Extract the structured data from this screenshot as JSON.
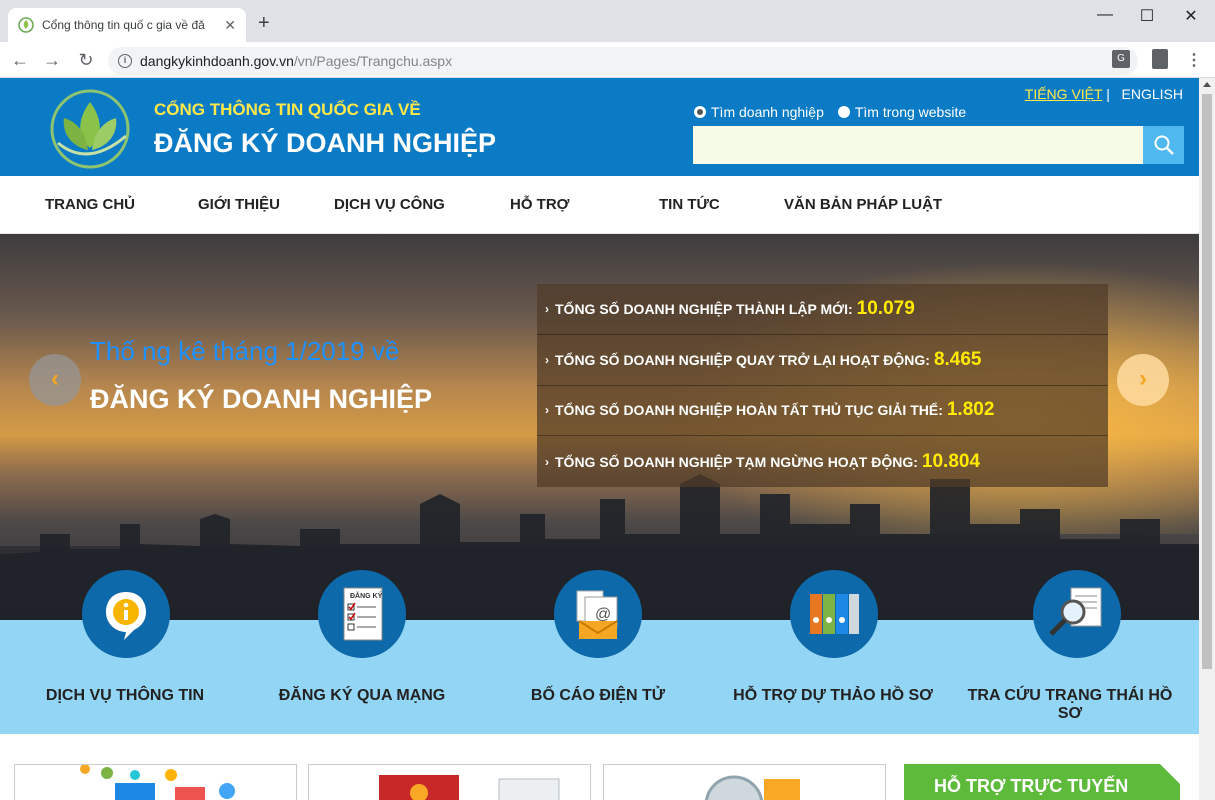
{
  "browser": {
    "tab_title": "Cổng thông tin quố c gia về đă",
    "url_host": "dangkykinhdoanh.gov.vn",
    "url_path": "/vn/Pages/Trangchu.aspx"
  },
  "header": {
    "subtitle": "CỔNG THÔNG TIN QUỐC GIA VỀ",
    "title": "ĐĂNG KÝ DOANH NGHIỆP",
    "lang_vi": "TIẾNG VIỆT",
    "lang_sep": "|",
    "lang_en": "ENGLISH",
    "search_option_1": "Tìm doanh nghiệp",
    "search_option_2": "Tìm trong website",
    "search_value": ""
  },
  "nav": {
    "items": [
      "TRANG CHỦ",
      "GIỚI THIỆU",
      "DỊCH VỤ CÔNG",
      "HỖ TRỢ",
      "TIN TỨC",
      "VĂN BẢN PHÁP LUẬT"
    ]
  },
  "banner": {
    "intro": "Thố ng kê tháng 1/2019 về",
    "heading": "ĐĂNG KÝ DOANH NGHIỆP",
    "stats": [
      {
        "label": "TỔNG SỐ DOANH NGHIỆP THÀNH LẬP MỚI:",
        "value": "10.079"
      },
      {
        "label": "TỔNG SỐ DOANH NGHIỆP QUAY TRỞ LẠI HOẠT ĐỘNG:",
        "value": "8.465"
      },
      {
        "label": "TỔNG SỐ DOANH NGHIỆP HOÀN TẤT THỦ TỤC GIẢI THỂ:",
        "value": "1.802"
      },
      {
        "label": "TỔNG SỐ DOANH NGHIỆP TẠM NGỪNG HOẠT ĐỘNG:",
        "value": "10.804"
      }
    ],
    "prev": "‹",
    "next": "›"
  },
  "services": [
    {
      "label": "DỊCH VỤ THÔNG TIN",
      "icon": "info-icon"
    },
    {
      "label": "ĐĂNG KÝ QUA MẠNG",
      "icon": "checklist-icon",
      "icon_text": "ĐĂNG KÝ"
    },
    {
      "label": "BỐ CÁO ĐIỆN TỬ",
      "icon": "email-icon"
    },
    {
      "label": "HỖ TRỢ DỰ THẢO HỒ SƠ",
      "icon": "binders-icon"
    },
    {
      "label": "TRA CỨU TRẠNG THÁI HỒ SƠ",
      "icon": "magnifier-document-icon"
    }
  ],
  "support": {
    "title": "HỖ TRỢ TRỰC TUYẾN"
  },
  "colors": {
    "header_blue": "#0c7bc6",
    "accent_yellow": "#ffe94a",
    "service_band": "#93d5f4",
    "support_green": "#5dba3a"
  }
}
